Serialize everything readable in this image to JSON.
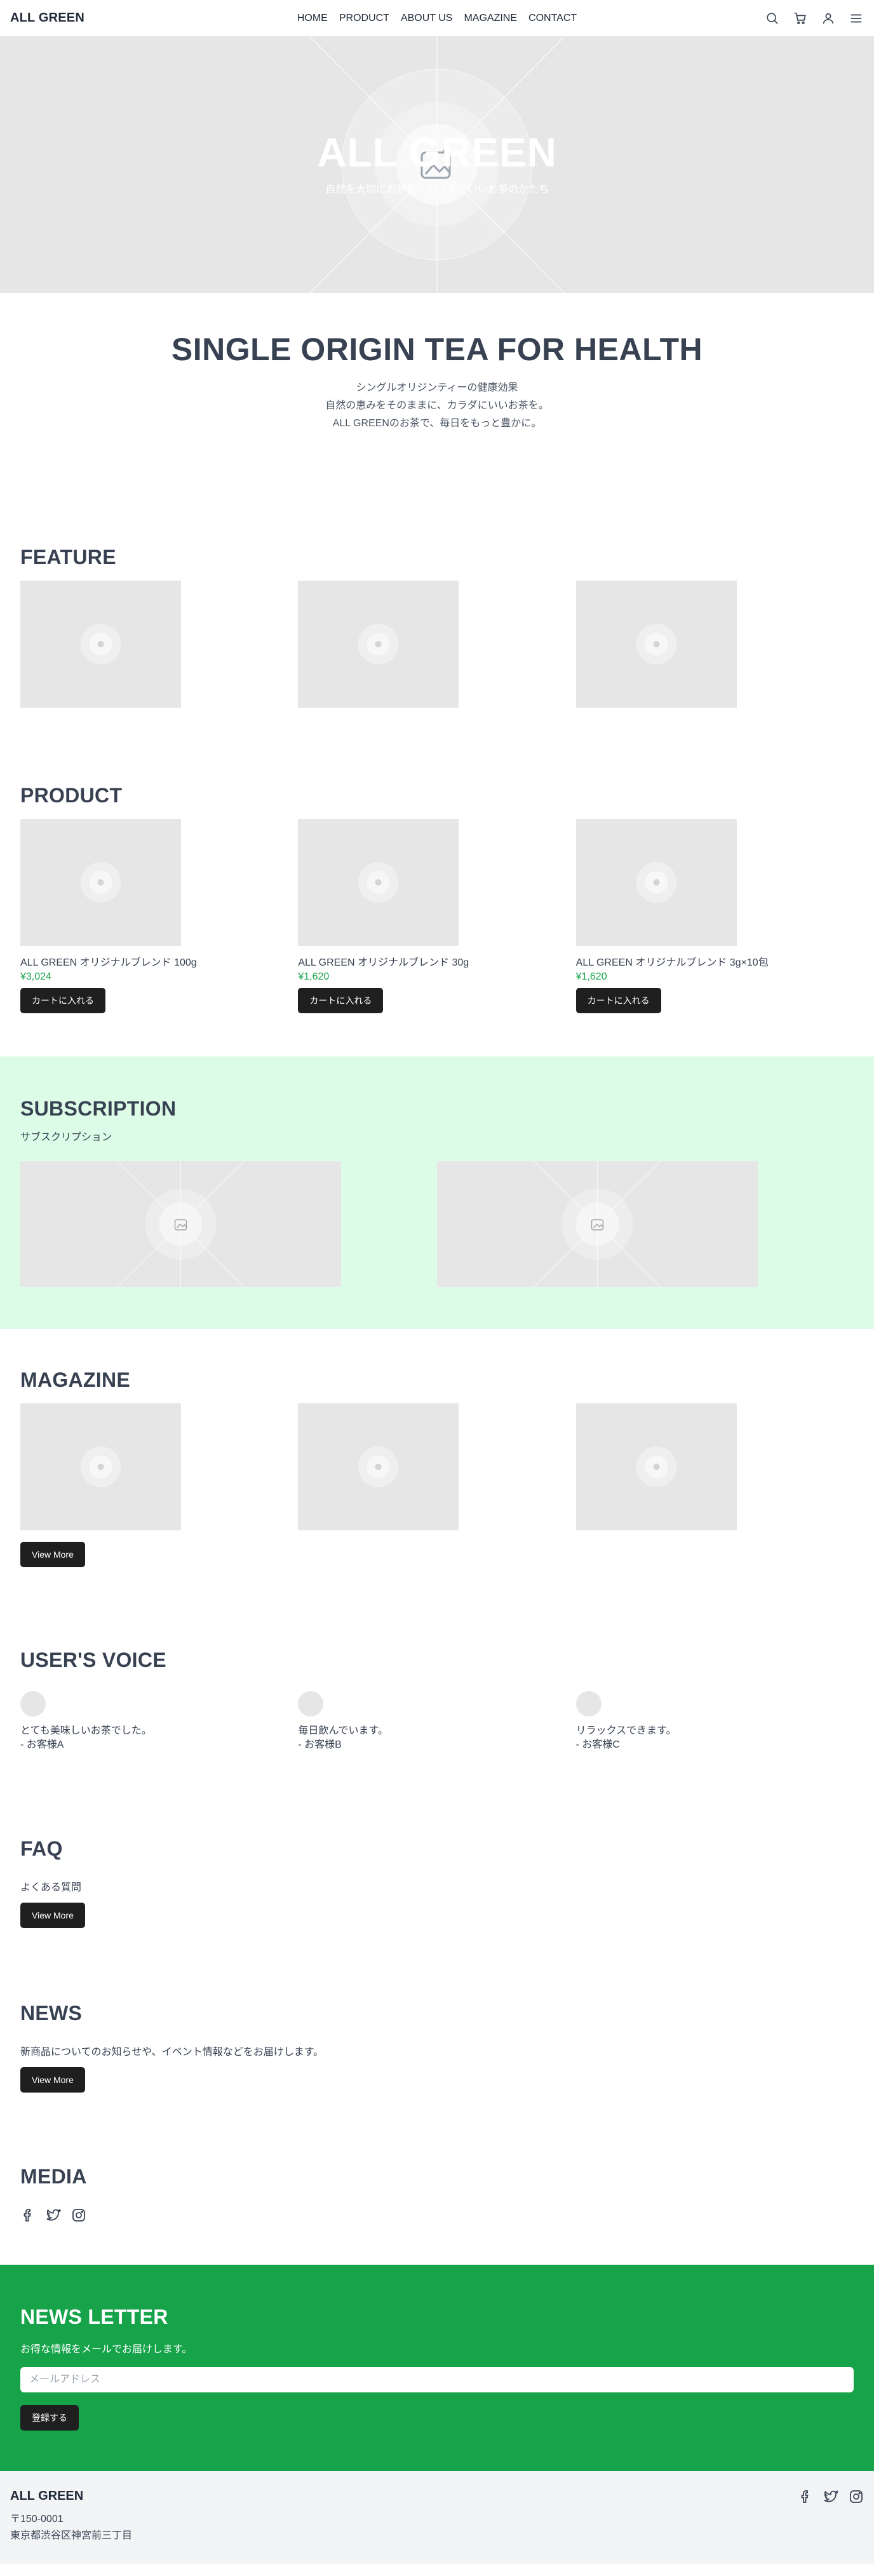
{
  "header": {
    "logo": "ALL GREEN",
    "nav": [
      "HOME",
      "PRODUCT",
      "ABOUT US",
      "MAGAZINE",
      "CONTACT"
    ],
    "icons": [
      "search-icon",
      "cart-icon",
      "user-icon",
      "menu-icon"
    ]
  },
  "hero": {
    "title": "ALL GREEN",
    "subtitle": "自然を大切にお茶を、カラダにいいお茶のかたち"
  },
  "intro": {
    "heading": "SINGLE ORIGIN TEA FOR HEALTH",
    "lines": [
      "シングルオリジンティーの健康効果",
      "自然の恵みをそのままに、カラダにいいお茶を。",
      "ALL GREENのお茶で、毎日をもっと豊かに。"
    ]
  },
  "feature": {
    "title": "FEATURE"
  },
  "product": {
    "title": "PRODUCT",
    "items": [
      {
        "name": "ALL GREEN オリジナルブレンド 100g",
        "price": "¥3,024",
        "button": "カートに入れる"
      },
      {
        "name": "ALL GREEN オリジナルブレンド 30g",
        "price": "¥1,620",
        "button": "カートに入れる"
      },
      {
        "name": "ALL GREEN オリジナルブレンド 3g×10包",
        "price": "¥1,620",
        "button": "カートに入れる"
      }
    ]
  },
  "subscription": {
    "title": "SUBSCRIPTION",
    "desc": "サブスクリプション"
  },
  "magazine": {
    "title": "MAGAZINE",
    "button": "View More"
  },
  "voice": {
    "title": "USER'S VOICE",
    "items": [
      {
        "text": "とても美味しいお茶でした。",
        "author": "- お客様A"
      },
      {
        "text": "毎日飲んでいます。",
        "author": "- お客様B"
      },
      {
        "text": "リラックスできます。",
        "author": "- お客様C"
      }
    ]
  },
  "faq": {
    "title": "FAQ",
    "desc": "よくある質問",
    "button": "View More"
  },
  "news": {
    "title": "NEWS",
    "desc": "新商品についてのお知らせや、イベント情報などをお届けします。",
    "button": "View More"
  },
  "media": {
    "title": "MEDIA",
    "icons": [
      "facebook-icon",
      "twitter-icon",
      "instagram-icon"
    ]
  },
  "newsletter": {
    "title": "NEWS LETTER",
    "desc": "お得な情報をメールでお届けします。",
    "placeholder": "メールアドレス",
    "button": "登録する"
  },
  "footer": {
    "logo": "ALL GREEN",
    "postal": "〒150-0001",
    "address": "東京都渋谷区神宮前三丁目"
  },
  "colors": {
    "accent_green": "#16a34a",
    "subscription_bg": "#dcfce7",
    "placeholder_bg": "#e6e6e6",
    "button_dark": "#1f1f1f"
  }
}
